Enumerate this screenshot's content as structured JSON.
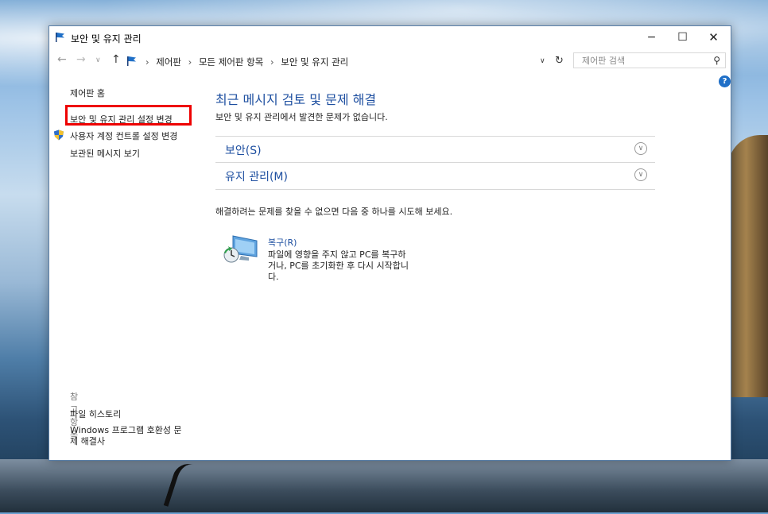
{
  "window": {
    "title": "보안 및 유지 관리",
    "controls": {
      "minimize": "−",
      "maximize": "☐",
      "close": "✕"
    }
  },
  "address_bar": {
    "crumbs": [
      "제어판",
      "모든 제어판 항목",
      "보안 및 유지 관리"
    ],
    "search_placeholder": "제어판 검색"
  },
  "sidebar": {
    "home": "제어판 홈",
    "settings": "보안 및 유지 관리 설정 변경",
    "uac": "사용자 계정 컨트롤 설정 변경",
    "messages": "보관된 메시지 보기",
    "see_also_title": "참고 항목",
    "file_history": "파일 히스토리",
    "compat": "Windows 프로그램 호환성 문제 해결사"
  },
  "main": {
    "title": "최근 메시지 검토 및 문제 해결",
    "subtitle": "보안 및 유지 관리에서 발견한 문제가 없습니다.",
    "sections": [
      "보안(S)",
      "유지 관리(M)"
    ],
    "trouble_text": "해결하려는 문제를 찾을 수 없으면 다음 중 하나를 시도해 보세요.",
    "recovery_link": "복구(R)",
    "recovery_desc": "파일에 영향을 주지 않고 PC를 복구하거나, PC를 초기화한 후 다시 시작합니다."
  },
  "colors": {
    "link_blue": "#1e4fa0",
    "highlight_red": "#e00000"
  }
}
